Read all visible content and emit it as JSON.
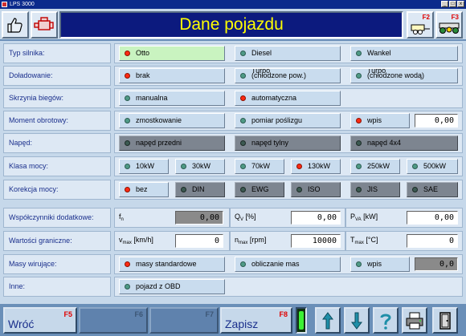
{
  "window": {
    "title": "LPS 3000",
    "controls": [
      "_",
      "□",
      "x"
    ]
  },
  "header": {
    "title": "Dane pojazdu",
    "left_icons": [
      "thumbs-up-icon",
      "engine-icon"
    ],
    "right_buttons": [
      {
        "key": "F2",
        "icon": "trailer-icon"
      },
      {
        "key": "F3",
        "icon": "vehicle-on-rollers-icon"
      }
    ]
  },
  "rows": [
    {
      "label": "Typ silnika:",
      "options": [
        {
          "text": "Otto",
          "on": true,
          "selected": true
        },
        {
          "text": "Diesel",
          "on": false
        },
        {
          "text": "Wankel",
          "on": false
        }
      ]
    },
    {
      "label": "Doładowanie:",
      "options": [
        {
          "text": "brak",
          "on": true
        },
        {
          "line1": "Turbo",
          "line2": "(chłodzone pow.)",
          "on": false
        },
        {
          "line1": "Turbo",
          "line2": "(chłodzone wodą)",
          "on": false
        }
      ]
    },
    {
      "label": "Skrzynia biegów:",
      "options": [
        {
          "text": "manualna",
          "on": false
        },
        {
          "text": "automatyczna",
          "on": true
        }
      ]
    },
    {
      "label": "Moment obrotowy:",
      "options": [
        {
          "text": "zmostkowanie",
          "on": false
        },
        {
          "text": "pomiar poślizgu",
          "on": false
        },
        {
          "text": "wpis",
          "on": true
        }
      ],
      "value": "0,00"
    },
    {
      "label": "Napęd:",
      "options": [
        {
          "text": "napęd przedni",
          "on": false,
          "disabled": true
        },
        {
          "text": "napęd tylny",
          "on": false,
          "disabled": true
        },
        {
          "text": "napęd 4x4",
          "on": false,
          "disabled": true
        }
      ]
    },
    {
      "label": "Klasa mocy:",
      "options": [
        {
          "text": "10kW",
          "on": false
        },
        {
          "text": "30kW",
          "on": false
        },
        {
          "text": "70kW",
          "on": false
        },
        {
          "text": "130kW",
          "on": true
        },
        {
          "text": "250kW",
          "on": false
        },
        {
          "text": "500kW",
          "on": false
        }
      ]
    },
    {
      "label": "Korekcja mocy:",
      "options": [
        {
          "text": "bez",
          "on": true
        },
        {
          "text": "DIN",
          "on": false,
          "disabled": true
        },
        {
          "text": "EWG",
          "on": false,
          "disabled": true
        },
        {
          "text": "ISO",
          "on": false,
          "disabled": true
        },
        {
          "text": "JIS",
          "on": false,
          "disabled": true
        },
        {
          "text": "SAE",
          "on": false,
          "disabled": true
        }
      ]
    },
    {
      "label": "Współczynniki dodatkowe:",
      "fields": [
        {
          "name": "f",
          "sub": "n",
          "unit": "",
          "value": "0,00",
          "gray": true
        },
        {
          "name": "Q",
          "sub": "V",
          "unit": " [%]",
          "value": "0,00"
        },
        {
          "name": "P",
          "sub": "VA",
          "unit": " [kW]",
          "value": "0,00"
        }
      ]
    },
    {
      "label": "Wartości graniczne:",
      "fields": [
        {
          "name": "v",
          "sub": "max",
          "unit": " [km/h]",
          "value": "0"
        },
        {
          "name": "n",
          "sub": "max",
          "unit": " [rpm]",
          "value": "10000"
        },
        {
          "name": "T",
          "sub": "max",
          "unit": " [°C]",
          "value": "0"
        }
      ]
    },
    {
      "label": "Masy wirujące:",
      "options": [
        {
          "text": "masy standardowe",
          "on": true
        },
        {
          "text": "obliczanie mas",
          "on": false
        },
        {
          "text": "wpis",
          "on": false
        }
      ],
      "value": "0,0"
    },
    {
      "label": "Inne:",
      "options": [
        {
          "text": "pojazd z OBD",
          "on": false
        }
      ]
    }
  ],
  "footer": {
    "buttons": [
      {
        "label": "Wróć",
        "key": "F5",
        "enabled": true
      },
      {
        "label": "",
        "key": "F6",
        "enabled": false
      },
      {
        "label": "",
        "key": "F7",
        "enabled": false
      },
      {
        "label": "Zapisz",
        "key": "F8",
        "enabled": true
      }
    ],
    "icons": [
      "arrow-up-icon",
      "arrow-down-icon",
      "help-icon",
      "printer-icon",
      "exit-door-icon"
    ]
  },
  "colors": {
    "title_bg": "#0c1a7e",
    "title_text": "#ffff00",
    "label_text": "#1a2f8c",
    "led_on": "#ff2a12",
    "led_off": "#4f9a86",
    "function_key": "#e00000"
  }
}
